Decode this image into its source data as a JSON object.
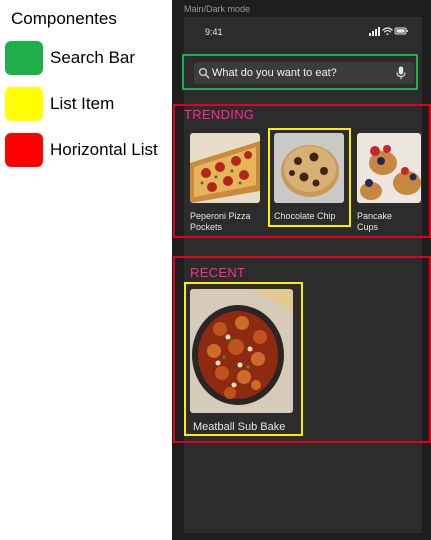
{
  "legend": {
    "title": "Componentes",
    "items": [
      {
        "label": "Search Bar",
        "color": "#1fb04a"
      },
      {
        "label": "List Item",
        "color": "#ffff00"
      },
      {
        "label": "Horizontal List",
        "color": "#ff0000"
      }
    ]
  },
  "frame": {
    "label": "Main/Dark mode"
  },
  "status_bar": {
    "time": "9:41"
  },
  "search": {
    "placeholder": "What do you want to eat?"
  },
  "trending": {
    "title": "TRENDING",
    "items": [
      {
        "name": "Peperoni Pizza Pockets"
      },
      {
        "name": "Chocolate Chip"
      },
      {
        "name": "Pancake Cups"
      }
    ]
  },
  "recent": {
    "title": "RECENT",
    "items": [
      {
        "name": "Meatball Sub Bake"
      }
    ]
  },
  "colors": {
    "accent": "#ff2d8d",
    "background": "#1e1e1e",
    "card": "#2c2c2c"
  }
}
